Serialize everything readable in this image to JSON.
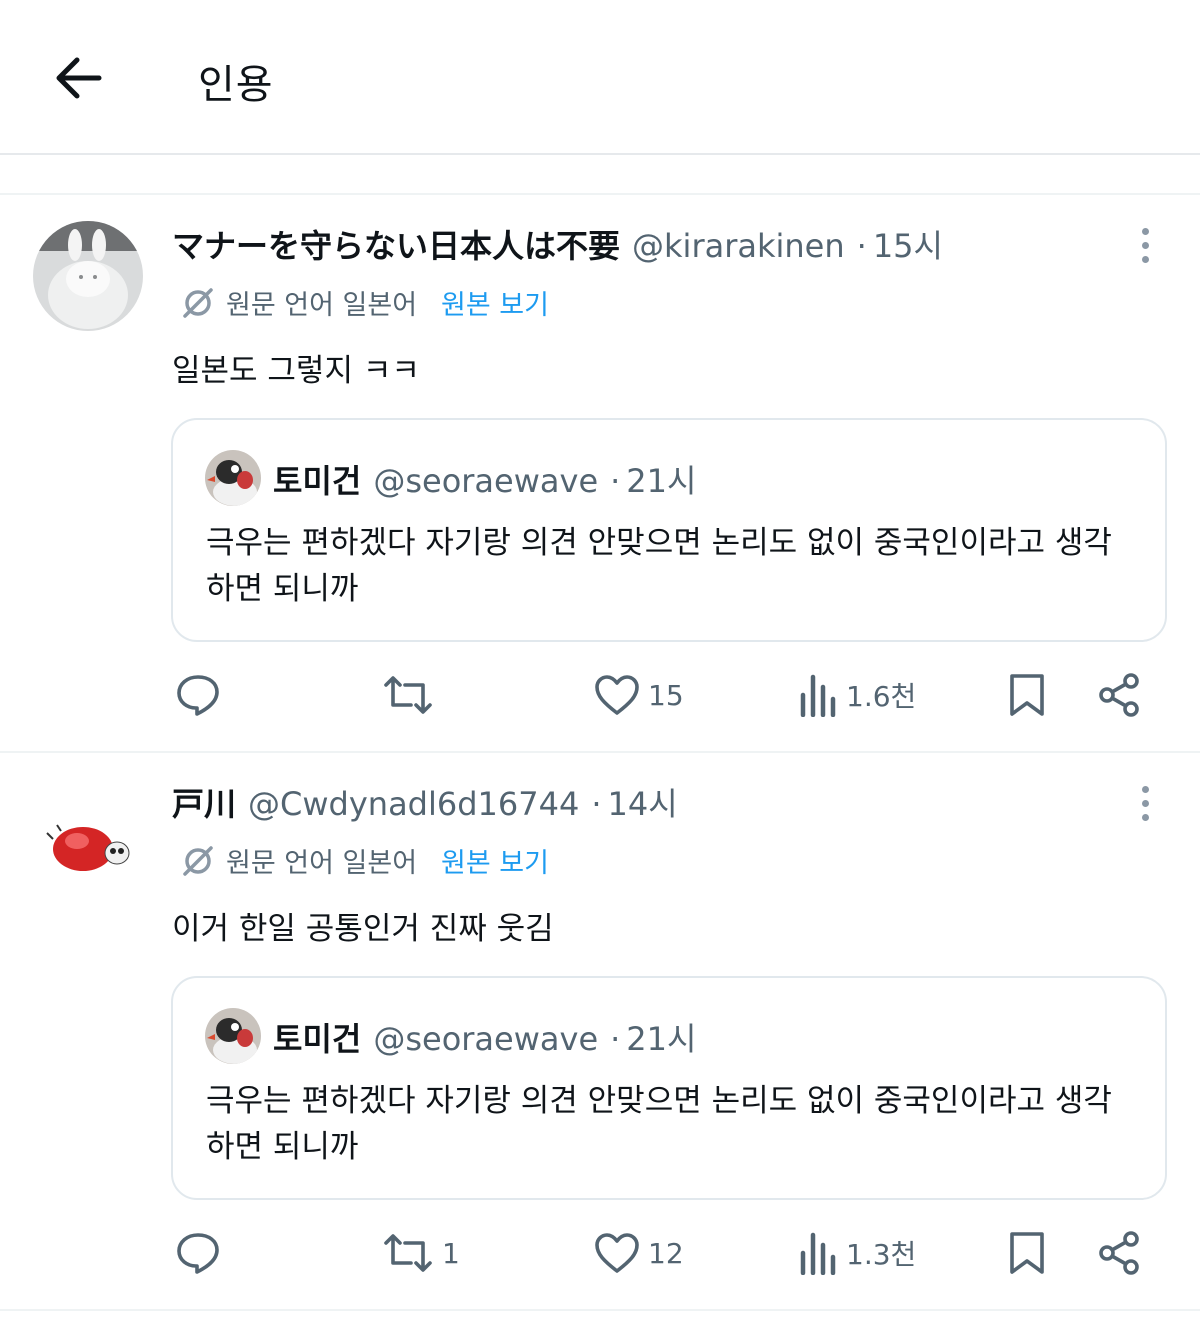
{
  "header": {
    "title": "인용"
  },
  "tweets": [
    {
      "display_name": "マナーを守らない日本人は不要",
      "handle": "@kirarakinen",
      "separator": "·",
      "time": "15시",
      "translate": {
        "lang_label": "원문 언어 일본어",
        "show_original": "원본 보기"
      },
      "text": "일본도 그렇지 ㅋㅋ",
      "quote": {
        "display_name": "토미건",
        "handle": "@seoraewave",
        "separator": "·",
        "time": "21시",
        "text": "극우는 편하겠다 자기랑 의견 안맞으면 논리도 없이 중국인이라고 생각하면 되니까"
      },
      "actions": {
        "replies": "",
        "reposts": "",
        "likes": "15",
        "views": "1.6천"
      }
    },
    {
      "display_name": "戸川",
      "handle": "@Cwdynadl6d16744",
      "separator": "·",
      "time": "14시",
      "translate": {
        "lang_label": "원문 언어 일본어",
        "show_original": "원본 보기"
      },
      "text": "이거 한일 공통인거 진짜 웃김",
      "quote": {
        "display_name": "토미건",
        "handle": "@seoraewave",
        "separator": "·",
        "time": "21시",
        "text": "극우는 편하겠다 자기랑 의견 안맞으면 논리도 없이 중국인이라고 생각하면 되니까"
      },
      "actions": {
        "replies": "",
        "reposts": "1",
        "likes": "12",
        "views": "1.3천"
      }
    }
  ],
  "colors": {
    "text": "#0f1419",
    "secondary": "#536471",
    "link": "#1d9bf0",
    "border": "#e1e8ed"
  },
  "icons": [
    "back-arrow-icon",
    "translate-icon",
    "more-icon",
    "reply-icon",
    "repost-icon",
    "like-icon",
    "views-icon",
    "bookmark-icon",
    "share-icon"
  ]
}
